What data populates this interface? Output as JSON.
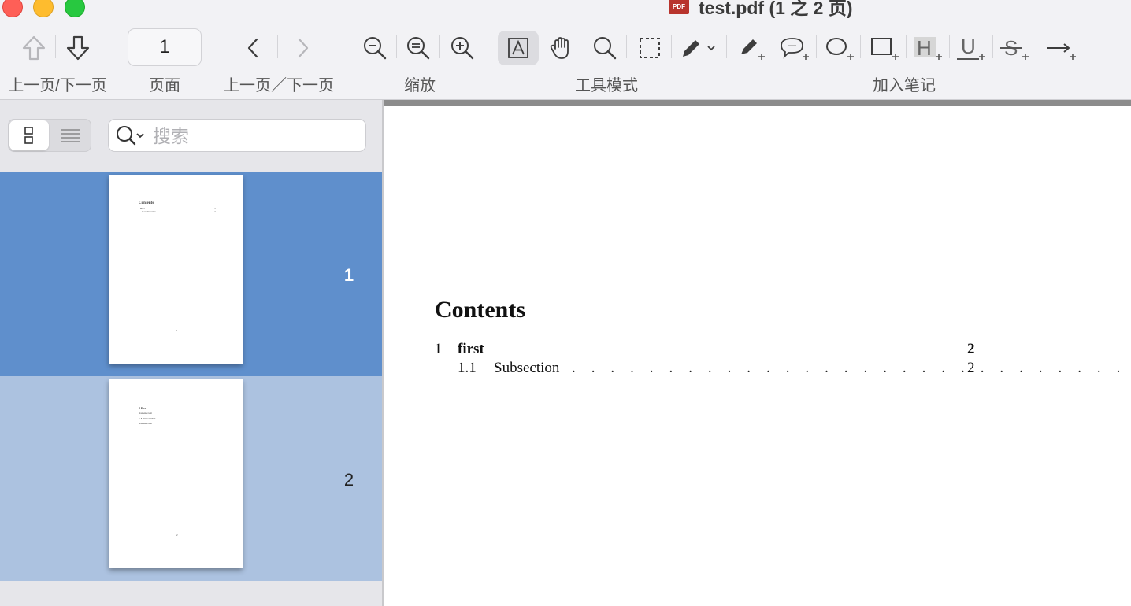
{
  "window": {
    "title": "test.pdf (1 之 2 页)",
    "file_badge": "PDF"
  },
  "toolbar": {
    "page_number": "1",
    "labels": {
      "prev_next_page": "上一页/下一页",
      "page": "页面",
      "prev_next": "上一页／下一页",
      "zoom": "缩放",
      "tool_mode": "工具模式",
      "add_annotation": "加入笔记"
    },
    "icons": [
      "up-arrow-icon",
      "down-arrow-icon",
      "chevron-left-icon",
      "chevron-right-icon",
      "zoom-out-icon",
      "zoom-fit-icon",
      "zoom-in-icon",
      "text-select-icon",
      "hand-icon",
      "magnifier-icon",
      "rect-select-icon",
      "pen-icon",
      "highlighter-icon",
      "speech-bubble-icon",
      "oval-icon",
      "rectangle-icon",
      "highlight-text-icon",
      "underline-icon",
      "strikethrough-icon",
      "arrow-icon"
    ],
    "annot_letters": {
      "highlight": "H",
      "underline": "U",
      "strike": "S"
    }
  },
  "sidebar": {
    "search_placeholder": "搜索",
    "thumbnails": [
      {
        "label": "1",
        "selected": true,
        "mini": {
          "heading": "Contents",
          "l1": "1   first",
          "l2": "1.1  Subsection",
          "pg": "2",
          "foot": "1"
        }
      },
      {
        "label": "2",
        "selected": false,
        "mini": {
          "heading": "1   first",
          "l1": "Nonsense text",
          "l2": "1.1   Subsection",
          "l3": "Nonsense text",
          "foot": "2"
        }
      }
    ]
  },
  "document": {
    "toc_heading": "Contents",
    "entries": [
      {
        "number": "1",
        "title": "first",
        "page": "2"
      },
      {
        "number": "1.1",
        "title": "Subsection",
        "page": "2",
        "leader": ". . . . . . . . . . . . . . . . . . . . . . . . . . . . . . . ."
      }
    ]
  },
  "colors": {
    "selected_thumb_bg": "#5f8fcc",
    "unselected_thumb_bg": "#acc2e0",
    "toolbar_bg": "#f2f2f5"
  }
}
